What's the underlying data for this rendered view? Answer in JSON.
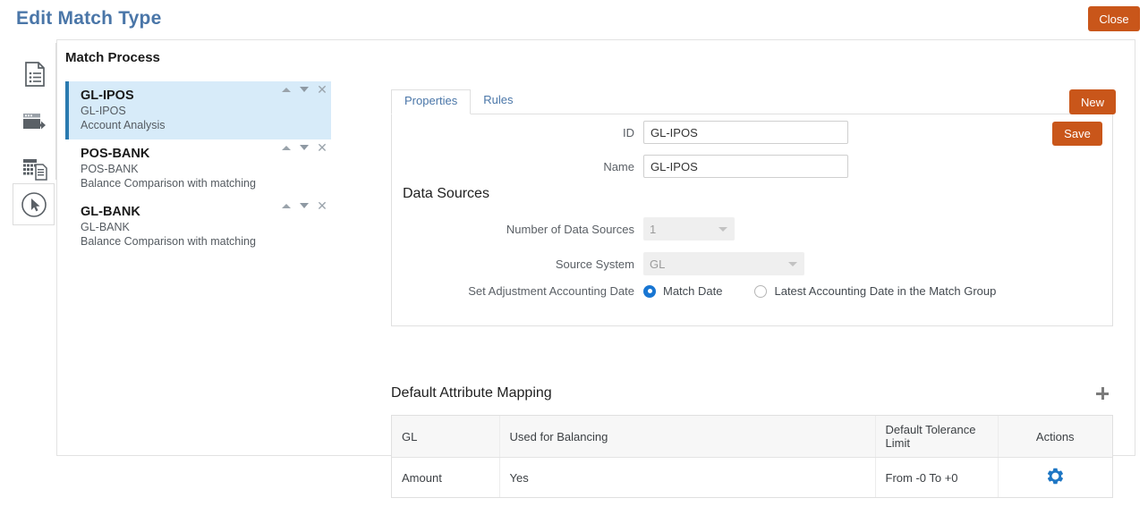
{
  "page": {
    "title": "Edit Match Type",
    "close_label": "Close"
  },
  "sidebar": {
    "items": [
      {
        "name": "document-list-icon",
        "label": "Document List"
      },
      {
        "name": "data-load-icon",
        "label": "Data Load"
      },
      {
        "name": "grid-report-icon",
        "label": "Grid Report"
      }
    ],
    "floating": {
      "name": "cursor-pointer-icon",
      "label": "Pointer"
    }
  },
  "match_process": {
    "heading": "Match Process",
    "new_label": "New",
    "items": [
      {
        "title": "GL-IPOS",
        "subtitle": "GL-IPOS",
        "description": "Account Analysis",
        "selected": true
      },
      {
        "title": "POS-BANK",
        "subtitle": "POS-BANK",
        "description": "Balance Comparison with matching",
        "selected": false
      },
      {
        "title": "GL-BANK",
        "subtitle": "GL-BANK",
        "description": "Balance Comparison with matching",
        "selected": false
      }
    ],
    "row_controls": {
      "up": "▲",
      "down": "▼",
      "close": "✕"
    }
  },
  "tabs": [
    {
      "label": "Properties",
      "active": true
    },
    {
      "label": "Rules",
      "active": false
    }
  ],
  "properties": {
    "save_label": "Save",
    "id": {
      "label": "ID",
      "value": "GL-IPOS",
      "placeholder": ""
    },
    "name": {
      "label": "Name",
      "value": "GL-IPOS",
      "placeholder": ""
    },
    "data_sources": {
      "heading": "Data Sources",
      "number_of_data_sources": {
        "label": "Number of Data Sources",
        "value": "1",
        "disabled": true
      },
      "source_system": {
        "label": "Source System",
        "value": "GL",
        "disabled": true
      },
      "adjustment_accounting_date": {
        "label": "Set Adjustment Accounting Date",
        "options": [
          {
            "label": "Match Date",
            "selected": true
          },
          {
            "label": "Latest Accounting Date in the Match Group",
            "selected": false
          }
        ]
      }
    }
  },
  "attribute_mapping": {
    "heading": "Default Attribute Mapping",
    "add_icon": "plus-icon",
    "columns": [
      "GL",
      "Used for Balancing",
      "Default Tolerance Limit",
      "Actions"
    ],
    "rows": [
      {
        "gl": "Amount",
        "used_for_balancing": "Yes",
        "default_tolerance_limit": "From -0 To +0",
        "action_icon": "gear-icon"
      }
    ]
  },
  "colors": {
    "accent_button": "#c9561a",
    "title_blue": "#4a76a8",
    "selected_row": "#d7ebf9",
    "selected_bar": "#2a7ab0",
    "radio_blue": "#1976d2",
    "gear_blue": "#1f77c4"
  }
}
